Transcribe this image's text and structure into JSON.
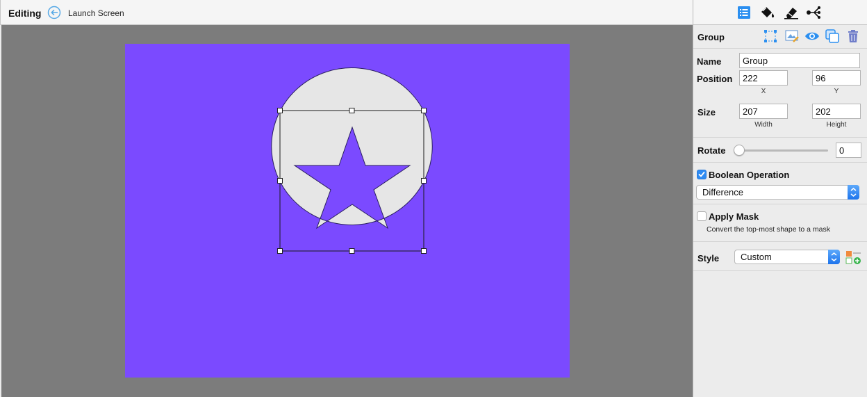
{
  "header": {
    "mode_label": "Editing",
    "back_icon": "back-arrow-icon",
    "breadcrumb": "Launch Screen"
  },
  "canvas": {
    "artboard_color": "#7b4aff",
    "shape_fill": "#e6e6e6",
    "shapes": [
      "circle",
      "star"
    ]
  },
  "inspector": {
    "tabs": [
      "list-icon",
      "paint-bucket-icon",
      "eraser-icon",
      "node-tree-icon"
    ],
    "group": {
      "title": "Group",
      "actions": [
        "bounding-box-icon",
        "image-edit-icon",
        "eye-icon",
        "duplicate-icon",
        "trash-icon"
      ]
    },
    "name": {
      "label": "Name",
      "value": "Group"
    },
    "position": {
      "label": "Position",
      "x": "222",
      "y": "96",
      "x_label": "X",
      "y_label": "Y"
    },
    "size": {
      "label": "Size",
      "width": "207",
      "height": "202",
      "width_label": "Width",
      "height_label": "Height"
    },
    "rotate": {
      "label": "Rotate",
      "value": "0"
    },
    "boolean": {
      "label": "Boolean Operation",
      "checked": true,
      "operation": "Difference"
    },
    "mask": {
      "label": "Apply Mask",
      "checked": false,
      "hint": "Convert the top-most shape to a mask"
    },
    "style": {
      "label": "Style",
      "value": "Custom",
      "add_icon": "add-style-icon"
    }
  },
  "colors": {
    "accent": "#2d8bf3",
    "canvas_bg": "#7c7c7c"
  }
}
